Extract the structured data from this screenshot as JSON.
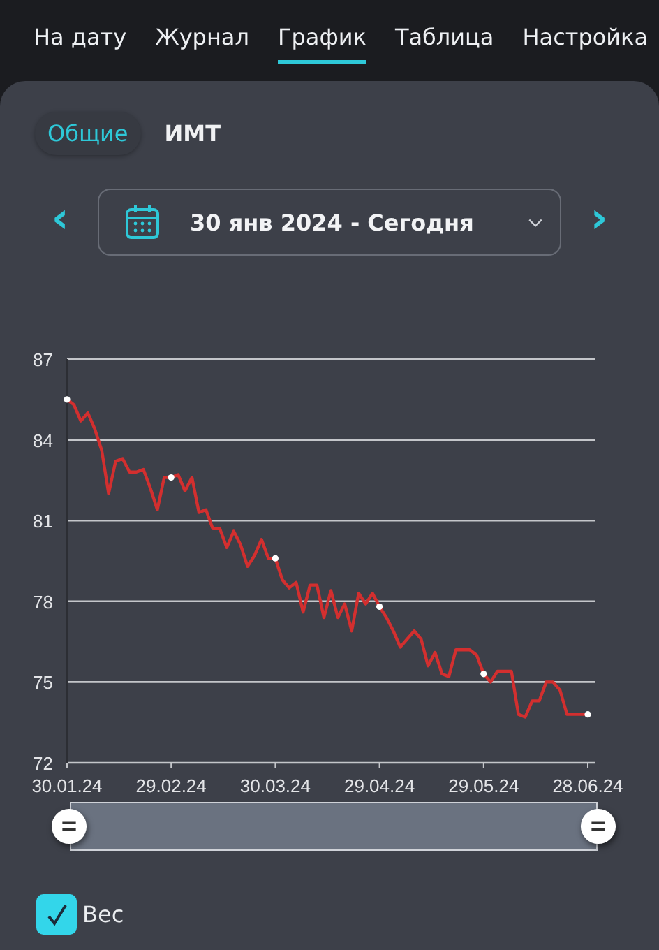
{
  "tabs": [
    {
      "label": "На дату",
      "selected": false
    },
    {
      "label": "Журнал",
      "selected": false
    },
    {
      "label": "График",
      "selected": true
    },
    {
      "label": "Таблица",
      "selected": false
    },
    {
      "label": "Настройка",
      "selected": false
    }
  ],
  "subtabs": [
    {
      "label": "Общие",
      "selected": true
    },
    {
      "label": "ИМТ",
      "selected": false
    }
  ],
  "date_range": {
    "prev": "‹",
    "value": "30 янв 2024 - Сегодня",
    "next": "›"
  },
  "chart_data": {
    "type": "line",
    "grid": true,
    "ylim": [
      72,
      87
    ],
    "yticks": [
      72,
      75,
      78,
      81,
      84,
      87
    ],
    "categories": [
      "30.01.24",
      null,
      null,
      null,
      null,
      null,
      null,
      null,
      null,
      null,
      null,
      null,
      null,
      null,
      null,
      "29.02.24",
      null,
      null,
      null,
      null,
      null,
      null,
      null,
      null,
      null,
      null,
      null,
      null,
      null,
      null,
      "30.03.24",
      null,
      null,
      null,
      null,
      null,
      null,
      null,
      null,
      null,
      null,
      null,
      null,
      null,
      null,
      "29.04.24",
      null,
      null,
      null,
      null,
      null,
      null,
      null,
      null,
      null,
      null,
      null,
      null,
      null,
      null,
      "29.05.24",
      null,
      null,
      null,
      null,
      null,
      null,
      null,
      null,
      null,
      null,
      null,
      null,
      null,
      null,
      "28.06.24"
    ],
    "series": [
      {
        "name": "Вес",
        "color": "#d32f2f",
        "values": [
          85.5,
          85.3,
          84.7,
          85.0,
          84.4,
          83.6,
          82.0,
          83.2,
          83.3,
          82.8,
          82.8,
          82.9,
          82.2,
          81.4,
          82.6,
          82.6,
          82.7,
          82.1,
          82.6,
          81.3,
          81.4,
          80.7,
          80.7,
          80.0,
          80.6,
          80.1,
          79.3,
          79.7,
          80.3,
          79.6,
          79.6,
          78.8,
          78.5,
          78.7,
          77.6,
          78.6,
          78.6,
          77.4,
          78.4,
          77.4,
          77.9,
          76.9,
          78.3,
          77.9,
          78.3,
          77.8,
          77.4,
          76.9,
          76.3,
          76.6,
          76.9,
          76.6,
          75.6,
          76.1,
          75.3,
          75.2,
          76.2,
          76.2,
          76.2,
          76.0,
          75.3,
          75.0,
          75.4,
          75.4,
          75.4,
          73.8,
          73.7,
          74.3,
          74.3,
          75.0,
          75.0,
          74.7,
          73.8,
          73.8,
          73.8,
          73.8
        ]
      }
    ]
  },
  "legend": {
    "checked": true
  }
}
